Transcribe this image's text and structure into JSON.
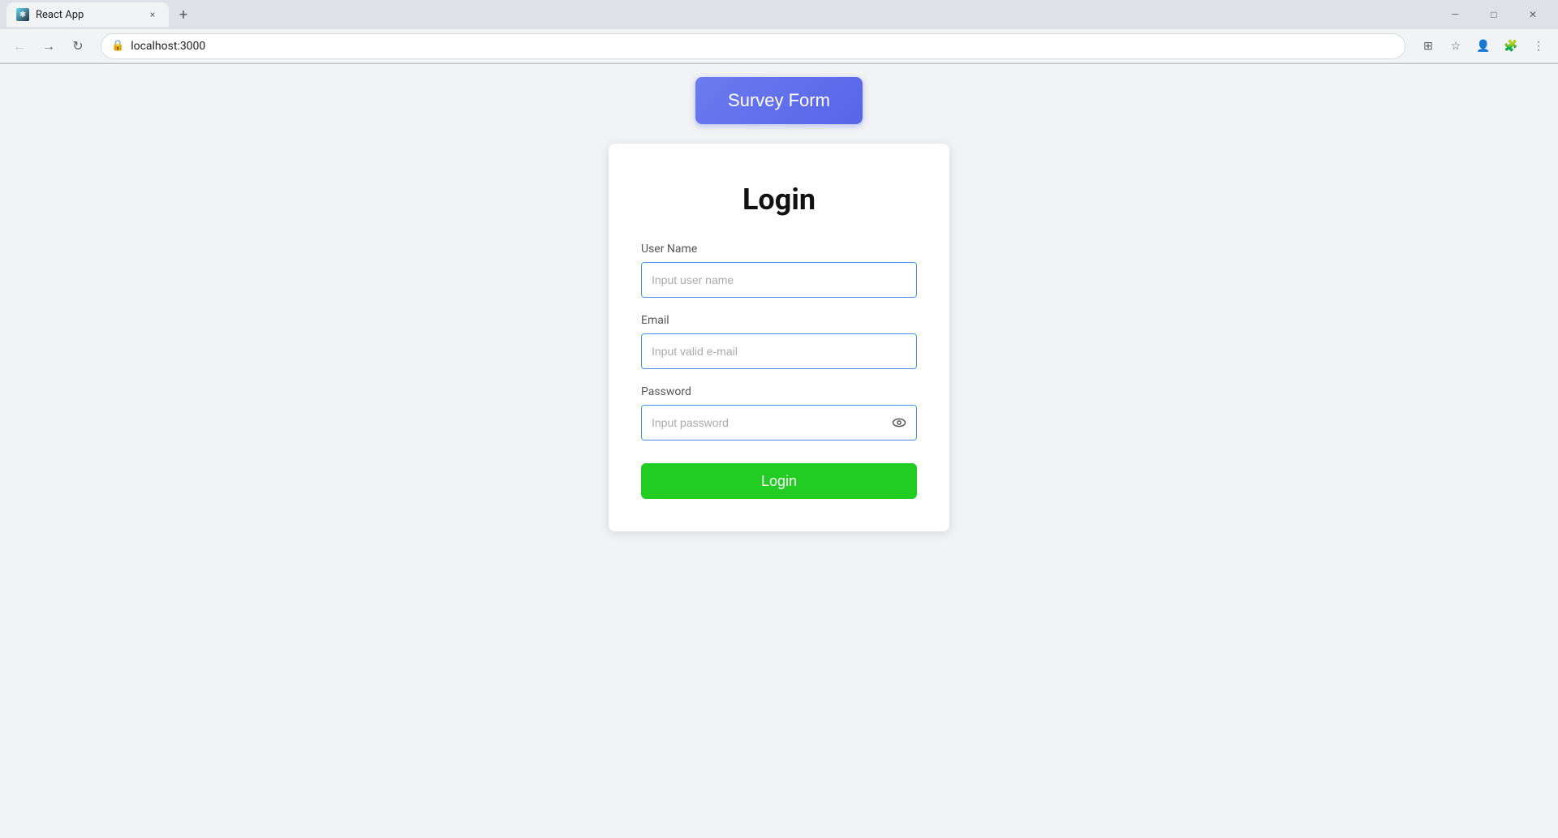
{
  "browser": {
    "tab_title": "React App",
    "tab_close": "×",
    "new_tab": "+",
    "url": "localhost:3000",
    "window_minimize": "—",
    "window_maximize": "□",
    "window_close": "×"
  },
  "header_button": {
    "label": "Survey Form"
  },
  "login_card": {
    "title": "Login",
    "username_label": "User Name",
    "username_placeholder": "Input user name",
    "email_label": "Email",
    "email_placeholder": "Input valid e-mail",
    "password_label": "Password",
    "password_placeholder": "Input password",
    "login_button_label": "Login"
  }
}
